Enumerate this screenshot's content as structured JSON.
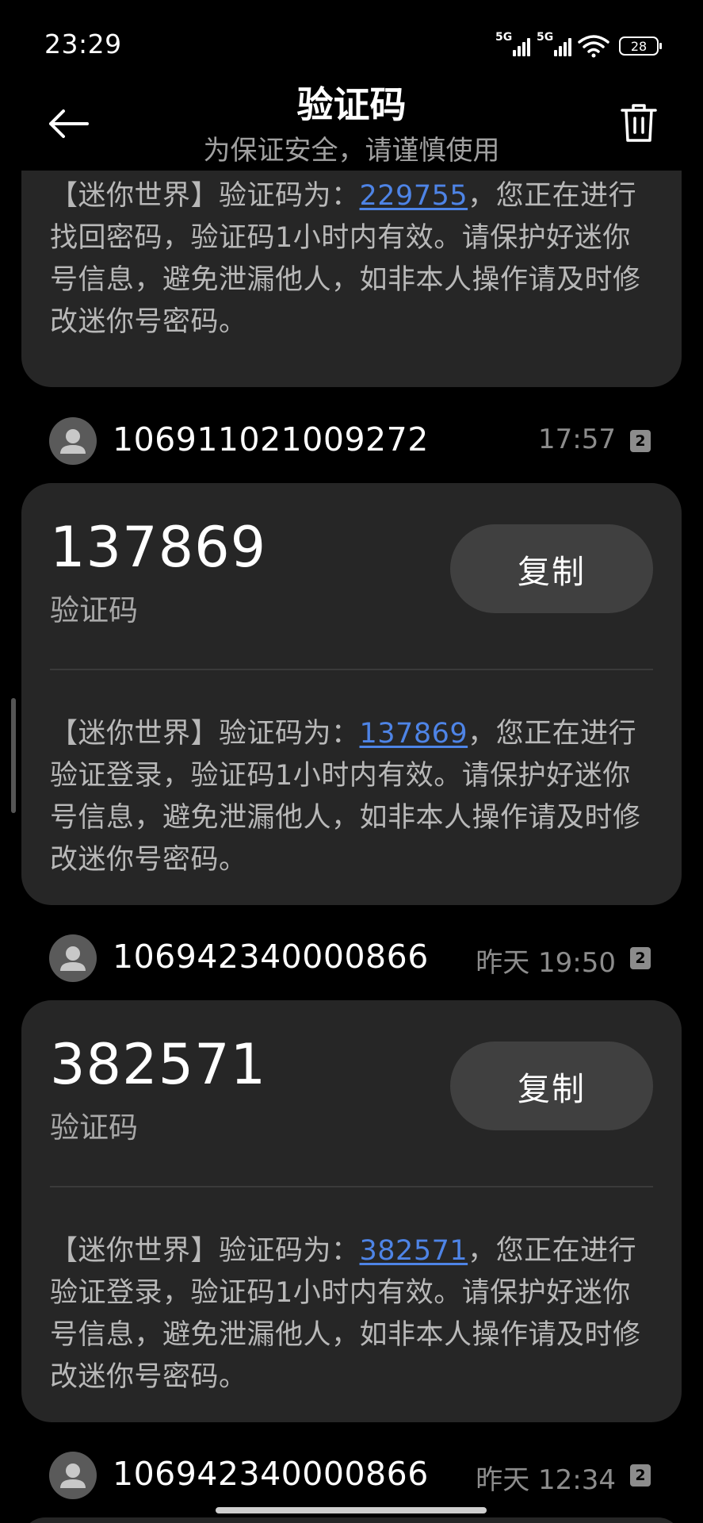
{
  "status_bar": {
    "time": "23:29",
    "signal1_label": "5G",
    "signal2_label": "5G",
    "battery_level": "28"
  },
  "header": {
    "title": "验证码",
    "subtitle": "为保证安全，请谨慎使用"
  },
  "partial_message": {
    "prefix": "【迷你世界】验证码为：",
    "code": "229755",
    "suffix": "，您正在进行找回密码，验证码1小时内有效。请保护好迷你号信息，避免泄漏他人，如非本人操作请及时修改迷你号密码。"
  },
  "messages": [
    {
      "sender": "106911021009272",
      "time": "17:57",
      "sim": "2",
      "code": "137869",
      "code_label": "验证码",
      "copy_label": "复制",
      "prefix": "【迷你世界】验证码为：",
      "suffix": "，您正在进行验证登录，验证码1小时内有效。请保护好迷你号信息，避免泄漏他人，如非本人操作请及时修改迷你号密码。"
    },
    {
      "sender": "106942340000866",
      "time": "昨天 19:50",
      "sim": "2",
      "code": "382571",
      "code_label": "验证码",
      "copy_label": "复制",
      "prefix": "【迷你世界】验证码为：",
      "suffix": "，您正在进行验证登录，验证码1小时内有效。请保护好迷你号信息，避免泄漏他人，如非本人操作请及时修改迷你号密码。"
    }
  ],
  "next_sender": {
    "sender": "106942340000866",
    "time": "昨天 12:34",
    "sim": "2"
  },
  "colors": {
    "background": "#000000",
    "card": "#262626",
    "link": "#4e84e6",
    "copy_button": "#404040"
  }
}
